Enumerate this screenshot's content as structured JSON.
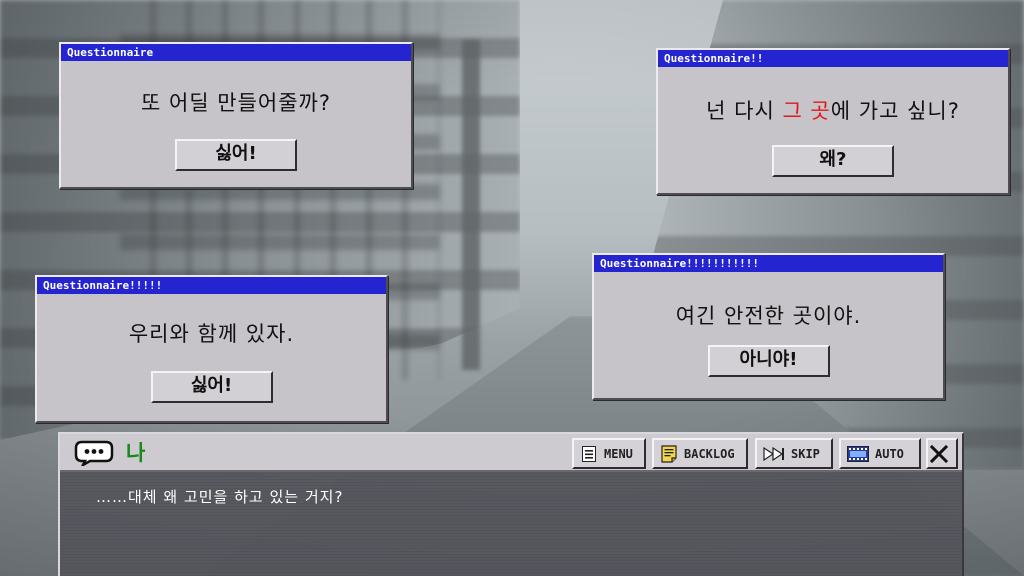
{
  "popups": [
    {
      "title": "Questionnaire",
      "message": "또 어딜 만들어줄까?",
      "button": "싫어!"
    },
    {
      "title": "Questionnaire!!",
      "message_before": "넌 다시 ",
      "message_highlight": "그 곳",
      "message_after": "에 가고 싶니?",
      "button": "왜?"
    },
    {
      "title": "Questionnaire!!!!!",
      "message": "우리와 함께 있자.",
      "button": "싫어!"
    },
    {
      "title": "Questionnaire!!!!!!!!!!!",
      "message": "여긴 안전한 곳이야.",
      "button": "아니야!"
    }
  ],
  "dialogue": {
    "speaker": "나",
    "text": "……대체 왜 고민을 하고 있는 거지?",
    "controls": {
      "menu": "MENU",
      "backlog": "BACKLOG",
      "skip": "SKIP",
      "auto": "AUTO"
    }
  },
  "icons": {
    "speaker": "speech-bubble-icon",
    "menu": "list-icon",
    "backlog": "notepad-icon",
    "skip": "fast-forward-icon",
    "auto": "film-icon",
    "close": "close-icon"
  },
  "colors": {
    "titlebar": "#2424d0",
    "highlight": "#e01818",
    "speaker_name": "#1a8a1a"
  }
}
